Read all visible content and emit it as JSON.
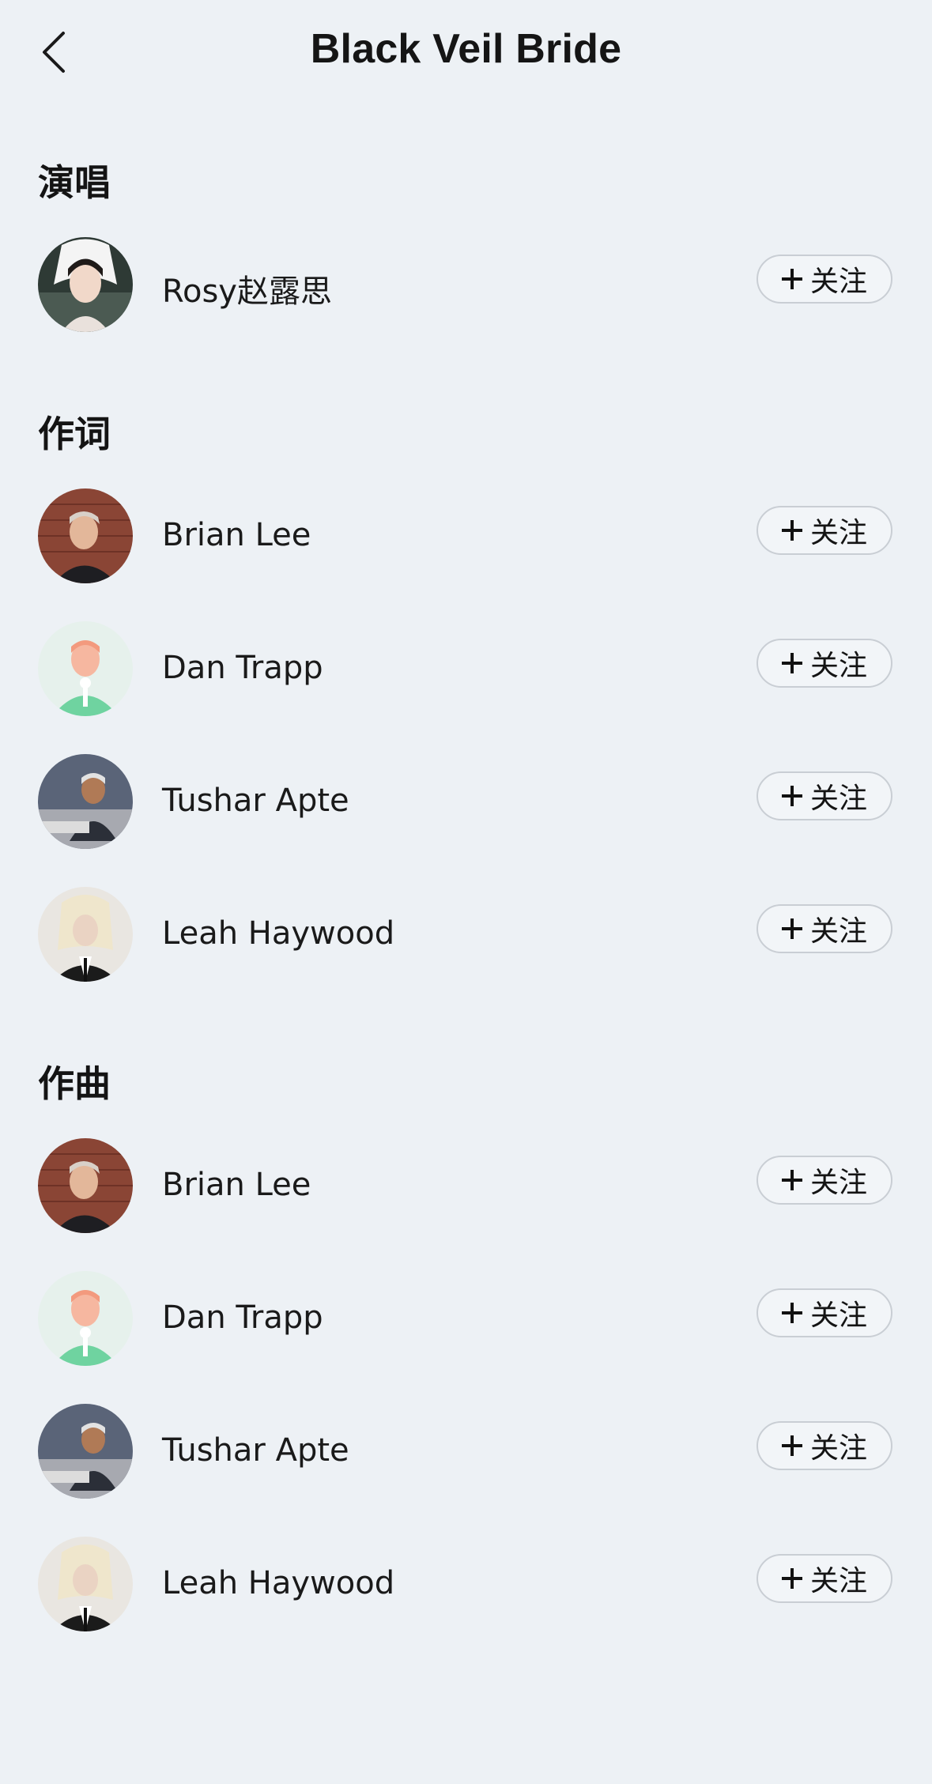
{
  "header": {
    "title": "Black Veil Bride",
    "back_icon": "chevron-left-icon"
  },
  "follow_label": "关注",
  "sections": [
    {
      "title": "演唱",
      "people": [
        {
          "name": "Rosy赵露思",
          "avatar": "photo-woman-veil"
        }
      ]
    },
    {
      "title": "作词",
      "people": [
        {
          "name": "Brian Lee",
          "avatar": "photo-man-brick"
        },
        {
          "name": "Dan Trapp",
          "avatar": "default-singer-illustration"
        },
        {
          "name": "Tushar Apte",
          "avatar": "photo-man-studio"
        },
        {
          "name": "Leah Haywood",
          "avatar": "photo-blonde-suit"
        }
      ]
    },
    {
      "title": "作曲",
      "people": [
        {
          "name": "Brian Lee",
          "avatar": "photo-man-brick"
        },
        {
          "name": "Dan Trapp",
          "avatar": "default-singer-illustration"
        },
        {
          "name": "Tushar Apte",
          "avatar": "photo-man-studio"
        },
        {
          "name": "Leah Haywood",
          "avatar": "photo-blonde-suit"
        }
      ]
    }
  ]
}
